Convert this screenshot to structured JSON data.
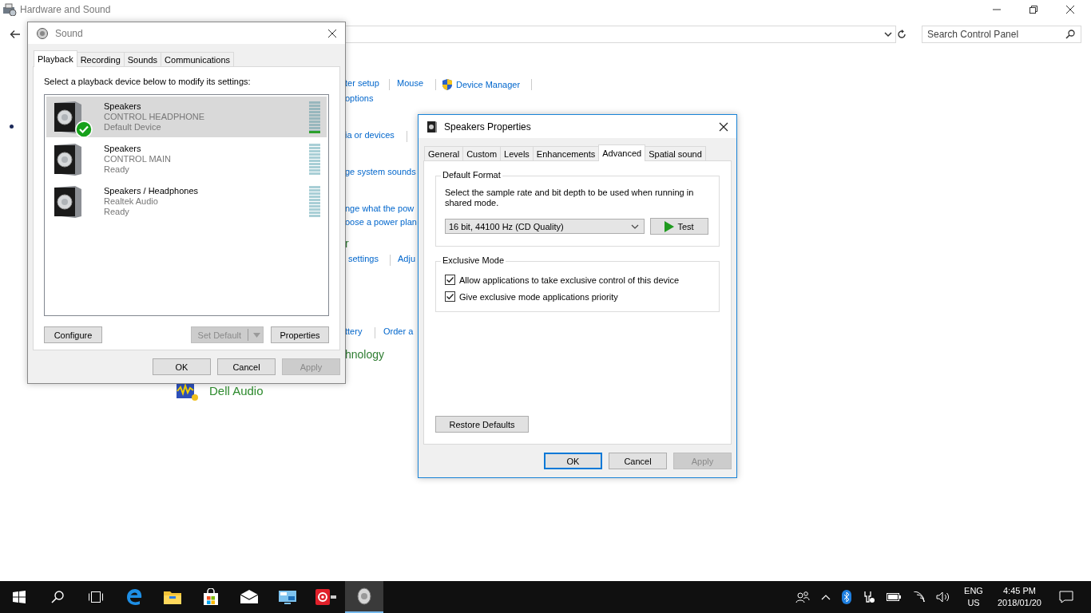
{
  "control_panel": {
    "title": "Hardware and Sound",
    "search": {
      "placeholder": "Search Control Panel"
    },
    "fragments": [
      {
        "text": "ter setup",
        "kind": "link"
      },
      {
        "text": "Mouse",
        "kind": "link"
      },
      {
        "text": "Device Manager",
        "kind": "admin-link"
      },
      {
        "text": "options",
        "kind": "link"
      },
      {
        "text": "ia or devices",
        "kind": "link"
      },
      {
        "text": "ge system sounds",
        "kind": "link"
      },
      {
        "text": "nge what the pow",
        "kind": "link"
      },
      {
        "text": "oose a power plan",
        "kind": "link"
      },
      {
        "text": "r",
        "kind": "heading"
      },
      {
        "text": "settings",
        "kind": "link"
      },
      {
        "text": "Adju",
        "kind": "link"
      },
      {
        "text": "ttery",
        "kind": "link"
      },
      {
        "text": "Order a",
        "kind": "link"
      },
      {
        "text": "hnology",
        "kind": "heading"
      },
      {
        "text": "Dell Audio",
        "kind": "app-heading"
      }
    ]
  },
  "sound_dialog": {
    "title": "Sound",
    "tabs": [
      {
        "label": "Playback",
        "selected": true
      },
      {
        "label": "Recording",
        "selected": false
      },
      {
        "label": "Sounds",
        "selected": false
      },
      {
        "label": "Communications",
        "selected": false
      }
    ],
    "instruction": "Select a playback device below to modify its settings:",
    "devices": [
      {
        "name": "Speakers",
        "description": "CONTROL HEADPHONE",
        "status": "Default Device",
        "default": true,
        "selected": true,
        "level": 0.1
      },
      {
        "name": "Speakers",
        "description": "CONTROL MAIN",
        "status": "Ready",
        "default": false,
        "selected": false
      },
      {
        "name": "Speakers / Headphones",
        "description": "Realtek Audio",
        "status": "Ready",
        "default": false,
        "selected": false
      }
    ],
    "configure_button": {
      "label": "Configure",
      "disabled": false
    },
    "set_default_button": {
      "label": "Set Default",
      "disabled": true
    },
    "properties_button": {
      "label": "Properties",
      "disabled": false
    },
    "buttons": [
      {
        "label": "OK",
        "disabled": false,
        "default": false
      },
      {
        "label": "Cancel",
        "disabled": false,
        "default": false
      },
      {
        "label": "Apply",
        "disabled": true,
        "default": false
      }
    ]
  },
  "properties_dialog": {
    "title": "Speakers Properties",
    "tabs": [
      {
        "label": "General",
        "selected": false
      },
      {
        "label": "Custom",
        "selected": false
      },
      {
        "label": "Levels",
        "selected": false
      },
      {
        "label": "Enhancements",
        "selected": false
      },
      {
        "label": "Advanced",
        "selected": true
      },
      {
        "label": "Spatial sound",
        "selected": false
      }
    ],
    "default_format": {
      "title": "Default Format",
      "description": "Select the sample rate and bit depth to be used when running in shared mode.",
      "format": "16 bit, 44100 Hz (CD Quality)",
      "test_button": "Test"
    },
    "exclusive_mode": {
      "title": "Exclusive Mode",
      "options": [
        {
          "label": "Allow applications to take exclusive control of this device",
          "checked": true
        },
        {
          "label": "Give exclusive mode applications priority",
          "checked": true
        }
      ]
    },
    "restore_button": "Restore Defaults",
    "buttons": [
      {
        "label": "OK",
        "disabled": false,
        "default": true
      },
      {
        "label": "Cancel",
        "disabled": false,
        "default": false
      },
      {
        "label": "Apply",
        "disabled": true,
        "default": false
      }
    ]
  },
  "taskbar": {
    "apps": [
      {
        "kind": "start",
        "selected": false
      },
      {
        "kind": "search",
        "selected": false
      },
      {
        "kind": "taskview",
        "selected": false
      },
      {
        "kind": "edge",
        "selected": false
      },
      {
        "kind": "explorer",
        "selected": false
      },
      {
        "kind": "store",
        "selected": false
      },
      {
        "kind": "mail",
        "selected": false
      },
      {
        "kind": "monitor",
        "selected": false
      },
      {
        "kind": "red-app",
        "selected": false
      },
      {
        "kind": "sound",
        "selected": true
      }
    ],
    "language": "ENG",
    "region": "US",
    "time": "4:45 PM",
    "date": "2018/01/20"
  }
}
